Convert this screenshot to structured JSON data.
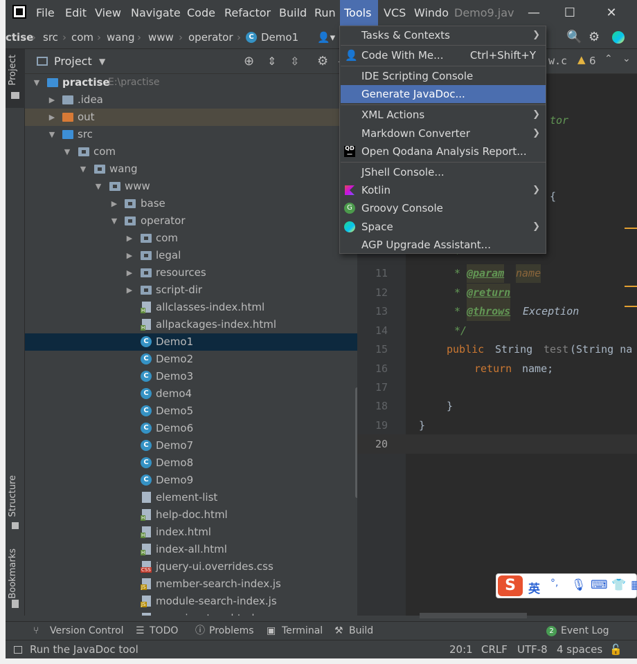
{
  "window": {
    "title": "Demo9.jav",
    "menus": [
      "File",
      "Edit",
      "View",
      "Navigate",
      "Code",
      "Refactor",
      "Build",
      "Run",
      "Tools",
      "VCS",
      "Windo"
    ],
    "active_menu": "Tools"
  },
  "breadcrumbs": [
    "ctise",
    "src",
    "com",
    "wang",
    "www",
    "operator",
    "Demo1"
  ],
  "left_tabs": [
    "Project",
    "Structure",
    "Bookmarks"
  ],
  "project_panel": {
    "title": "Project",
    "root_name": "practise",
    "root_path": "E:\\practise",
    "tree": [
      ".idea",
      "out",
      "src",
      "com",
      "wang",
      "www",
      "base",
      "operator",
      "com",
      "legal",
      "resources",
      "script-dir",
      "allclasses-index.html",
      "allpackages-index.html",
      "Demo1",
      "Demo2",
      "Demo3",
      "demo4",
      "Demo5",
      "Demo6",
      "Demo7",
      "Demo8",
      "Demo9",
      "element-list",
      "help-doc.html",
      "index.html",
      "index-all.html",
      "jquery-ui.overrides.css",
      "member-search-index.js",
      "module-search-index.js",
      "overview-tree.html"
    ]
  },
  "editor": {
    "tab_fragment": "w.c",
    "warnings": "6",
    "fragments": {
      "ator": "tor",
      "brace": "{"
    },
    "line_numbers": [
      "11",
      "12",
      "13",
      "14",
      "15",
      "16",
      "17",
      "18",
      "19",
      "20"
    ],
    "code": {
      "l10_star": "*",
      "param_tag": "@param",
      "param_name": "name",
      "return_tag": "@return",
      "throws_tag": "@throws",
      "throws_type": "Exception",
      "end_comment": "*/",
      "kw_public": "public",
      "type_string": "String",
      "method": "test",
      "sig_rest": "(String na",
      "kw_return": "return",
      "ret_rest": "name;",
      "brace_close": "}",
      "class_close": "}",
      "star": "*"
    }
  },
  "tools_menu": {
    "items": [
      {
        "label": "Tasks & Contexts",
        "shortcut": "",
        "submenu": true
      },
      {
        "label": "Code With Me...",
        "shortcut": "Ctrl+Shift+Y",
        "submenu": false
      },
      {
        "label": "IDE Scripting Console",
        "shortcut": "",
        "submenu": false
      },
      {
        "label": "Generate JavaDoc...",
        "shortcut": "",
        "submenu": false
      },
      {
        "label": "XML Actions",
        "shortcut": "",
        "submenu": true
      },
      {
        "label": "Markdown Converter",
        "shortcut": "",
        "submenu": true
      },
      {
        "label": "Open Qodana Analysis Report...",
        "shortcut": "",
        "submenu": false
      },
      {
        "label": "JShell Console...",
        "shortcut": "",
        "submenu": false
      },
      {
        "label": "Kotlin",
        "shortcut": "",
        "submenu": true
      },
      {
        "label": "Groovy Console",
        "shortcut": "",
        "submenu": false
      },
      {
        "label": "Space",
        "shortcut": "",
        "submenu": true
      },
      {
        "label": "AGP Upgrade Assistant...",
        "shortcut": "",
        "submenu": false
      }
    ],
    "highlighted": "Generate JavaDoc..."
  },
  "bottom_tools": [
    "Version Control",
    "TODO",
    "Problems",
    "Terminal",
    "Build"
  ],
  "event_log": {
    "count": "2",
    "label": "Event Log"
  },
  "status": {
    "message": "Run the JavaDoc tool",
    "position": "20:1",
    "line_sep": "CRLF",
    "encoding": "UTF-8",
    "indent": "4 spaces"
  },
  "ime": {
    "mode": "英",
    "punct": "°,"
  },
  "colors": {
    "accent": "#4b6eaf",
    "selection": "#0d293e",
    "bg": "#3c3f41",
    "editor_bg": "#2b2b2b"
  }
}
